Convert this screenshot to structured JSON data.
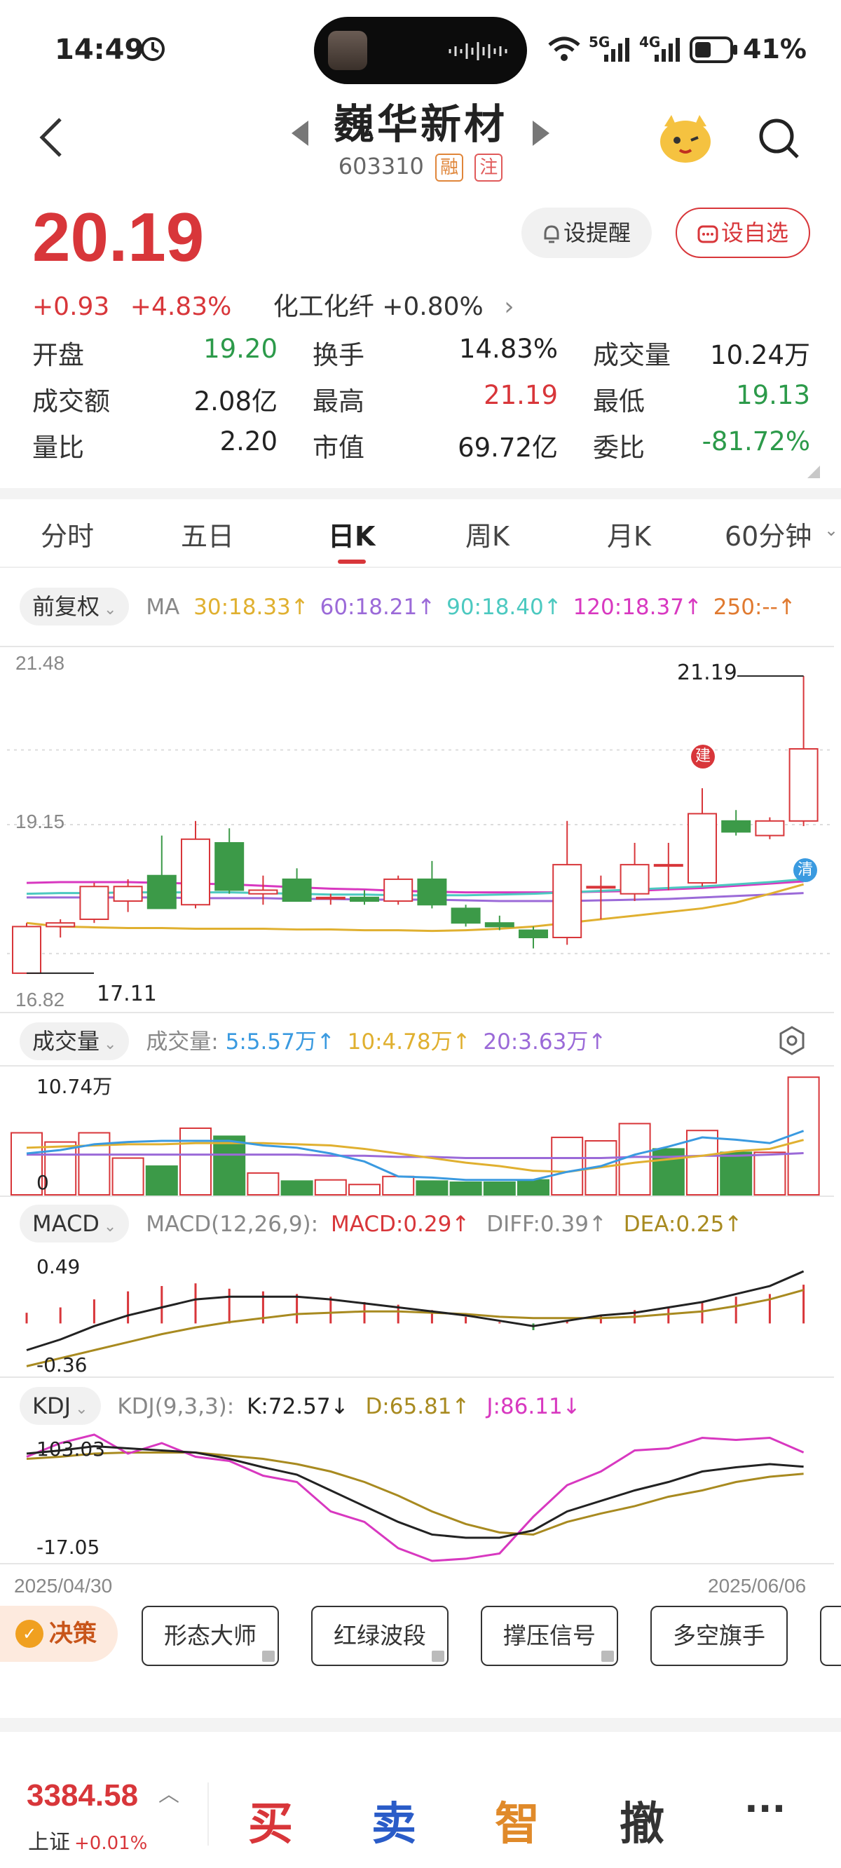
{
  "status": {
    "time": "14:49",
    "battery": "41%",
    "signal_5g": "5G",
    "signal_4g": "4G"
  },
  "header": {
    "name": "巍华新材",
    "code": "603310",
    "tag1": "融",
    "tag2": "注"
  },
  "quote": {
    "price": "20.19",
    "change": "+0.93",
    "change_pct": "+4.83%",
    "sector": "化工化纤 +0.80%",
    "remind_label": "设提醒",
    "fav_label": "设自选"
  },
  "stats": [
    {
      "label": "开盘",
      "value": "19.20",
      "color": "#2c9a4a"
    },
    {
      "label": "换手",
      "value": "14.83%",
      "color": "#222222"
    },
    {
      "label": "成交量",
      "value": "10.24万",
      "color": "#222222"
    },
    {
      "label": "成交额",
      "value": "2.08亿",
      "color": "#222222"
    },
    {
      "label": "最高",
      "value": "21.19",
      "color": "#d8363a"
    },
    {
      "label": "最低",
      "value": "19.13",
      "color": "#2c9a4a"
    },
    {
      "label": "量比",
      "value": "2.20",
      "color": "#222222"
    },
    {
      "label": "市值",
      "value": "69.72亿",
      "color": "#222222"
    },
    {
      "label": "委比",
      "value": "-81.72%",
      "color": "#2c9a4a"
    }
  ],
  "tabs": [
    "分时",
    "五日",
    "日K",
    "周K",
    "月K",
    "60分钟"
  ],
  "active_tab": "日K",
  "ma": {
    "mode": "前复权",
    "label": "MA",
    "items": [
      {
        "text": "30:18.33↑",
        "color": "#e0b030"
      },
      {
        "text": "60:18.21↑",
        "color": "#9b6ad8"
      },
      {
        "text": "90:18.40↑",
        "color": "#4cc9c0"
      },
      {
        "text": "120:18.37↑",
        "color": "#d838c0"
      },
      {
        "text": "250:--↑",
        "color": "#e07a30"
      }
    ]
  },
  "kline": {
    "ymax_label": "21.48",
    "ymid_label": "19.15",
    "ymin_label": "16.82",
    "high_label": "21.19",
    "low_label": "17.11",
    "mark_build": "建",
    "mark_clear": "清"
  },
  "volume": {
    "label": "成交量",
    "title": "成交量:",
    "items": [
      {
        "text": "5:5.57万↑",
        "color": "#3a9ae0"
      },
      {
        "text": "10:4.78万↑",
        "color": "#e0b030"
      },
      {
        "text": "20:3.63万↑",
        "color": "#9b6ad8"
      }
    ],
    "max_label": "10.74万",
    "zero_label": "0"
  },
  "macd": {
    "label": "MACD",
    "params": "MACD(12,26,9):",
    "items": [
      {
        "text": "MACD:0.29↑",
        "color": "#d8363a"
      },
      {
        "text": "DIFF:0.39↑",
        "color": "#888888"
      },
      {
        "text": "DEA:0.25↑",
        "color": "#a88a20"
      }
    ],
    "max_label": "0.49",
    "min_label": "-0.36"
  },
  "kdj": {
    "label": "KDJ",
    "params": "KDJ(9,3,3):",
    "items": [
      {
        "text": "K:72.57↓",
        "color": "#222222"
      },
      {
        "text": "D:65.81↑",
        "color": "#a88a20"
      },
      {
        "text": "J:86.11↓",
        "color": "#d838c0"
      }
    ],
    "max_label": "103.03",
    "min_label": "-17.05"
  },
  "dates": {
    "start": "2025/04/30",
    "end": "2025/06/06"
  },
  "chart_data": {
    "type": "candlestick",
    "x_start": "2025/04/30",
    "x_end": "2025/06/06",
    "ylim": [
      16.82,
      21.48
    ],
    "candles": [
      {
        "o": 17.11,
        "h": 17.8,
        "l": 17.11,
        "c": 17.75
      },
      {
        "o": 17.75,
        "h": 17.85,
        "l": 17.6,
        "c": 17.8
      },
      {
        "o": 17.85,
        "h": 18.35,
        "l": 17.8,
        "c": 18.3
      },
      {
        "o": 18.1,
        "h": 18.4,
        "l": 17.95,
        "c": 18.3
      },
      {
        "o": 18.45,
        "h": 19.0,
        "l": 18.0,
        "c": 18.0
      },
      {
        "o": 18.05,
        "h": 19.2,
        "l": 18.0,
        "c": 18.95
      },
      {
        "o": 18.9,
        "h": 19.1,
        "l": 18.2,
        "c": 18.25
      },
      {
        "o": 18.2,
        "h": 18.45,
        "l": 18.05,
        "c": 18.25
      },
      {
        "o": 18.4,
        "h": 18.55,
        "l": 18.1,
        "c": 18.1
      },
      {
        "o": 18.15,
        "h": 18.2,
        "l": 18.05,
        "c": 18.15
      },
      {
        "o": 18.15,
        "h": 18.25,
        "l": 18.05,
        "c": 18.1
      },
      {
        "o": 18.1,
        "h": 18.45,
        "l": 18.05,
        "c": 18.4
      },
      {
        "o": 18.4,
        "h": 18.65,
        "l": 18.0,
        "c": 18.05
      },
      {
        "o": 18.0,
        "h": 18.05,
        "l": 17.75,
        "c": 17.8
      },
      {
        "o": 17.8,
        "h": 17.9,
        "l": 17.7,
        "c": 17.75
      },
      {
        "o": 17.7,
        "h": 17.75,
        "l": 17.45,
        "c": 17.6
      },
      {
        "o": 17.6,
        "h": 19.2,
        "l": 17.5,
        "c": 18.6
      },
      {
        "o": 18.3,
        "h": 18.45,
        "l": 17.85,
        "c": 18.3
      },
      {
        "o": 18.2,
        "h": 18.9,
        "l": 18.1,
        "c": 18.6
      },
      {
        "o": 18.6,
        "h": 18.9,
        "l": 18.25,
        "c": 18.6
      },
      {
        "o": 18.35,
        "h": 19.65,
        "l": 18.3,
        "c": 19.3
      },
      {
        "o": 19.2,
        "h": 19.35,
        "l": 19.0,
        "c": 19.05
      },
      {
        "o": 19.0,
        "h": 19.25,
        "l": 18.95,
        "c": 19.2
      },
      {
        "o": 19.2,
        "h": 21.19,
        "l": 19.13,
        "c": 20.19
      }
    ],
    "ma30": [
      17.8,
      17.75,
      17.74,
      17.73,
      17.73,
      17.72,
      17.72,
      17.72,
      17.71,
      17.71,
      17.7,
      17.7,
      17.69,
      17.7,
      17.72,
      17.75,
      17.8,
      17.85,
      17.9,
      17.95,
      18.0,
      18.08,
      18.2,
      18.33
    ],
    "ma60": [
      18.15,
      18.15,
      18.15,
      18.15,
      18.15,
      18.14,
      18.14,
      18.14,
      18.13,
      18.13,
      18.12,
      18.12,
      18.12,
      18.11,
      18.1,
      18.1,
      18.1,
      18.11,
      18.12,
      18.13,
      18.15,
      18.17,
      18.19,
      18.21
    ],
    "ma90": [
      18.2,
      18.21,
      18.21,
      18.22,
      18.22,
      18.22,
      18.22,
      18.21,
      18.2,
      18.19,
      18.19,
      18.18,
      18.18,
      18.18,
      18.19,
      18.2,
      18.22,
      18.24,
      18.26,
      18.28,
      18.3,
      18.33,
      18.36,
      18.4
    ],
    "ma120": [
      18.35,
      18.36,
      18.36,
      18.36,
      18.35,
      18.34,
      18.33,
      18.31,
      18.29,
      18.27,
      18.26,
      18.24,
      18.23,
      18.22,
      18.22,
      18.22,
      18.22,
      18.23,
      18.24,
      18.26,
      18.28,
      18.31,
      18.34,
      18.37
    ],
    "volume": [
      5.4,
      4.6,
      5.4,
      3.2,
      2.5,
      5.8,
      5.1,
      1.9,
      1.2,
      1.3,
      0.9,
      1.6,
      1.2,
      1.1,
      1.1,
      1.3,
      5.0,
      4.7,
      6.2,
      4.0,
      5.6,
      3.7,
      3.7,
      10.24
    ],
    "volume_up": [
      1,
      1,
      1,
      1,
      0,
      1,
      0,
      1,
      0,
      1,
      1,
      1,
      0,
      0,
      0,
      0,
      1,
      1,
      1,
      0,
      1,
      0,
      1,
      1
    ],
    "vol_ma5": [
      3.6,
      3.9,
      4.4,
      4.6,
      4.7,
      4.7,
      4.7,
      4.3,
      4.1,
      3.6,
      2.9,
      1.6,
      1.5,
      1.3,
      1.3,
      1.3,
      2.0,
      2.5,
      3.5,
      4.2,
      5.0,
      4.8,
      4.5,
      5.57
    ],
    "vol_ma10": [
      4.1,
      4.2,
      4.3,
      4.4,
      4.4,
      4.5,
      4.5,
      4.5,
      4.4,
      4.3,
      4.0,
      3.6,
      3.2,
      2.8,
      2.5,
      2.1,
      2.0,
      2.4,
      2.8,
      3.1,
      3.4,
      3.8,
      4.0,
      4.78
    ],
    "vol_ma20": [
      3.5,
      3.5,
      3.5,
      3.5,
      3.5,
      3.5,
      3.5,
      3.5,
      3.5,
      3.4,
      3.4,
      3.3,
      3.3,
      3.2,
      3.2,
      3.2,
      3.2,
      3.2,
      3.3,
      3.3,
      3.4,
      3.4,
      3.5,
      3.63
    ],
    "macd_hist": [
      0.08,
      0.12,
      0.18,
      0.24,
      0.28,
      0.3,
      0.26,
      0.24,
      0.22,
      0.2,
      0.16,
      0.14,
      0.1,
      0.05,
      0.01,
      -0.05,
      0.02,
      0.06,
      0.1,
      0.12,
      0.16,
      0.2,
      0.22,
      0.29
    ],
    "macd_diff": [
      -0.2,
      -0.12,
      -0.02,
      0.06,
      0.12,
      0.18,
      0.2,
      0.2,
      0.2,
      0.18,
      0.15,
      0.12,
      0.09,
      0.06,
      0.02,
      -0.02,
      0.02,
      0.06,
      0.08,
      0.12,
      0.16,
      0.22,
      0.28,
      0.39
    ],
    "macd_dea": [
      -0.32,
      -0.26,
      -0.2,
      -0.14,
      -0.08,
      -0.03,
      0.01,
      0.04,
      0.07,
      0.08,
      0.09,
      0.09,
      0.08,
      0.07,
      0.05,
      0.04,
      0.04,
      0.04,
      0.05,
      0.07,
      0.09,
      0.13,
      0.18,
      0.25
    ],
    "kdj_k": [
      85,
      88,
      92,
      90,
      88,
      86,
      80,
      72,
      65,
      50,
      35,
      20,
      8,
      5,
      5,
      12,
      30,
      40,
      50,
      58,
      68,
      72,
      75,
      72.57
    ],
    "kdj_d": [
      80,
      82,
      85,
      86,
      86,
      86,
      83,
      80,
      75,
      68,
      58,
      45,
      30,
      18,
      10,
      8,
      20,
      28,
      35,
      44,
      50,
      58,
      63,
      65.81
    ],
    "kdj_j": [
      82,
      95,
      103.03,
      85,
      95,
      82,
      78,
      64,
      58,
      30,
      20,
      -5,
      -17.05,
      -15,
      -10,
      25,
      55,
      68,
      88,
      90,
      100,
      98,
      100,
      86.11
    ]
  },
  "decision": {
    "label": "决策",
    "tools": [
      "形态大师",
      "红绿波段",
      "撑压信号",
      "多空旗手"
    ]
  },
  "bottom": {
    "index_value": "3384.58",
    "index_name": "上证",
    "index_change": "+0.01%",
    "buy": "买",
    "sell": "卖",
    "smart": "智",
    "cancel": "撤",
    "more": "···"
  }
}
